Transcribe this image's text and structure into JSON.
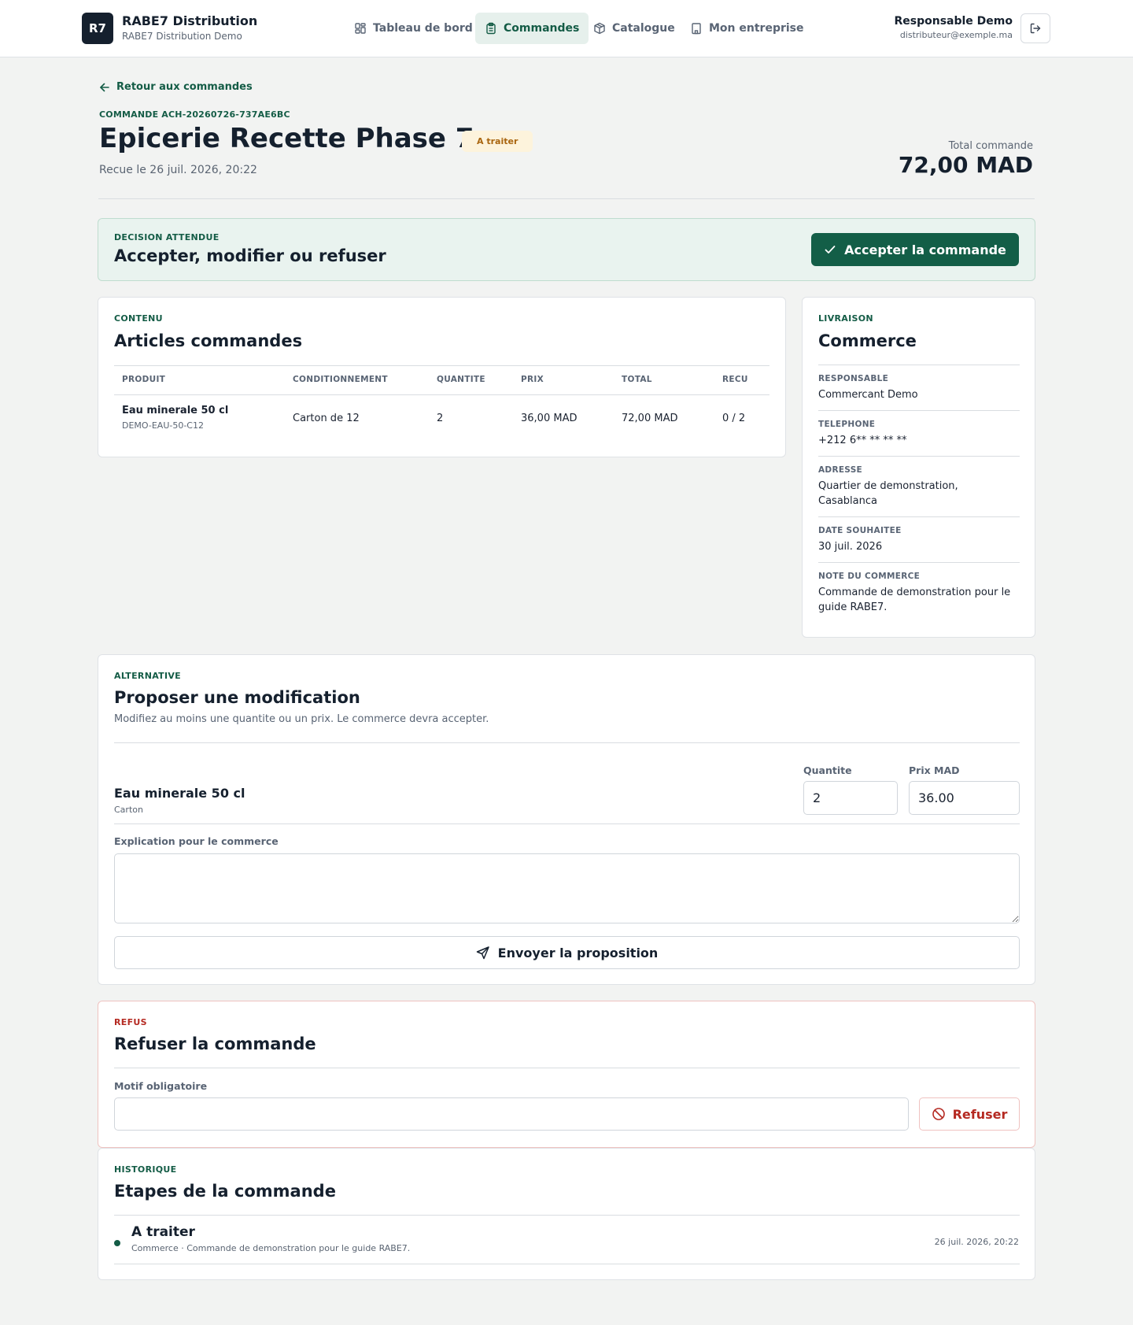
{
  "header": {
    "logo": "R7",
    "brand_name": "RABE7 Distribution",
    "brand_sub": "RABE7 Distribution Demo",
    "nav": [
      {
        "label": "Tableau de bord",
        "icon": "dashboard-icon"
      },
      {
        "label": "Commandes",
        "icon": "clipboard-icon",
        "active": true
      },
      {
        "label": "Catalogue",
        "icon": "package-icon"
      },
      {
        "label": "Mon entreprise",
        "icon": "building-icon"
      }
    ],
    "user_name": "Responsable Demo",
    "user_email": "distributeur@exemple.ma",
    "logout_icon": "logout-icon"
  },
  "order": {
    "back_label": "Retour aux commandes",
    "ref": "COMMANDE ACH-20260726-737AE6BC",
    "title": "Epicerie Recette Phase 7",
    "status": "A traiter",
    "received": "Recue le 26 juil. 2026, 20:22",
    "total_label": "Total commande",
    "total_value": "72,00 MAD"
  },
  "decision": {
    "eyebrow": "DECISION ATTENDUE",
    "title": "Accepter, modifier ou refuser",
    "accept_label": "Accepter la commande"
  },
  "articles": {
    "eyebrow": "CONTENU",
    "title": "Articles commandes",
    "columns": [
      "PRODUIT",
      "CONDITIONNEMENT",
      "QUANTITE",
      "PRIX",
      "TOTAL",
      "RECU"
    ],
    "rows": [
      {
        "product": "Eau minerale 50 cl",
        "sku": "DEMO-EAU-50-C12",
        "packaging": "Carton de 12",
        "quantity": "2",
        "price": "36,00 MAD",
        "total": "72,00 MAD",
        "received": "0 / 2"
      }
    ]
  },
  "livraison": {
    "eyebrow": "LIVRAISON",
    "title": "Commerce",
    "fields": [
      {
        "label": "RESPONSABLE",
        "value": "Commercant Demo"
      },
      {
        "label": "TELEPHONE",
        "value": "+212 6** ** ** **"
      },
      {
        "label": "ADRESSE",
        "value": "Quartier de demonstration, Casablanca"
      },
      {
        "label": "DATE SOUHAITEE",
        "value": "30 juil. 2026"
      },
      {
        "label": "NOTE DU COMMERCE",
        "value": "Commande de demonstration pour le guide RABE7."
      }
    ]
  },
  "alternative": {
    "eyebrow": "ALTERNATIVE",
    "title": "Proposer une modification",
    "description": "Modifiez au moins une quantite ou un prix. Le commerce devra accepter.",
    "product": "Eau minerale 50 cl",
    "unit": "Carton",
    "quantity_label": "Quantite",
    "quantity_value": "2",
    "price_label": "Prix MAD",
    "price_value": "36.00",
    "explanation_label": "Explication pour le commerce",
    "explanation_value": "",
    "send_label": "Envoyer la proposition"
  },
  "refus": {
    "eyebrow": "REFUS",
    "title": "Refuser la commande",
    "reason_label": "Motif obligatoire",
    "reason_value": "",
    "refuse_label": "Refuser"
  },
  "historique": {
    "eyebrow": "HISTORIQUE",
    "title": "Etapes de la commande",
    "steps": [
      {
        "title": "A traiter",
        "description": "Commerce · Commande de demonstration pour le guide RABE7.",
        "date": "26 juil. 2026, 20:22"
      }
    ]
  },
  "colors": {
    "accent": "#135e47",
    "danger": "#b52a22",
    "badge_bg": "#fdf3dc",
    "badge_text": "#a9650f",
    "page_bg": "#f2f3f2"
  }
}
